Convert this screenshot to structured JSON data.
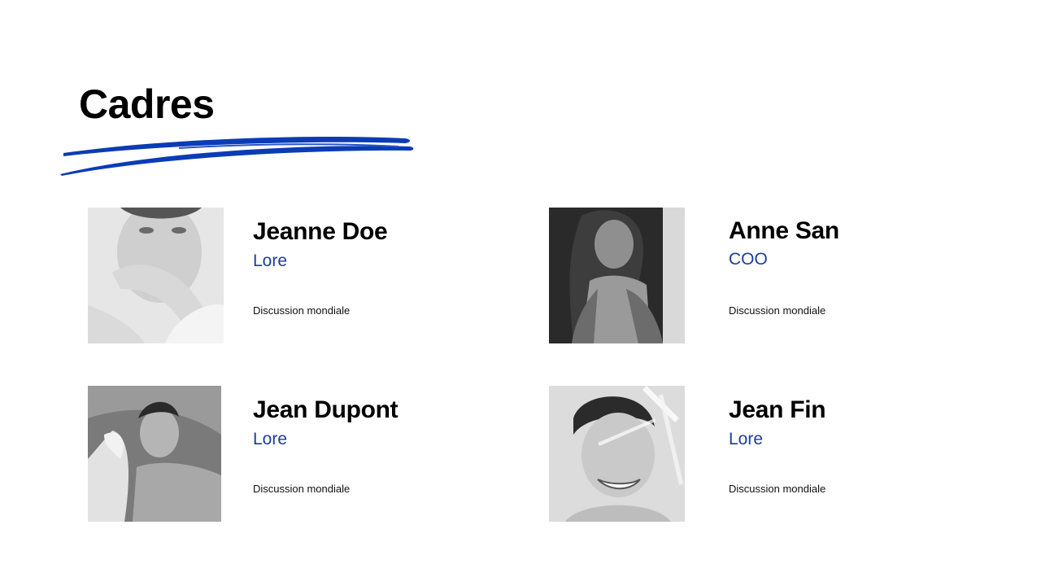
{
  "slide": {
    "title": "Cadres",
    "accent_color": "#0a3cb4",
    "role_color": "#1c3f96"
  },
  "people": [
    {
      "name": "Jeanne Doe",
      "role": "Lore",
      "description": "Discussion mondiale",
      "photo_icon": "portrait-photo"
    },
    {
      "name": "Anne San",
      "role": "COO",
      "description": "Discussion mondiale",
      "photo_icon": "portrait-photo"
    },
    {
      "name": "Jean Dupont",
      "role": "Lore",
      "description": "Discussion mondiale",
      "photo_icon": "portrait-photo"
    },
    {
      "name": "Jean Fin",
      "role": "Lore",
      "description": "Discussion mondiale",
      "photo_icon": "portrait-photo"
    }
  ]
}
